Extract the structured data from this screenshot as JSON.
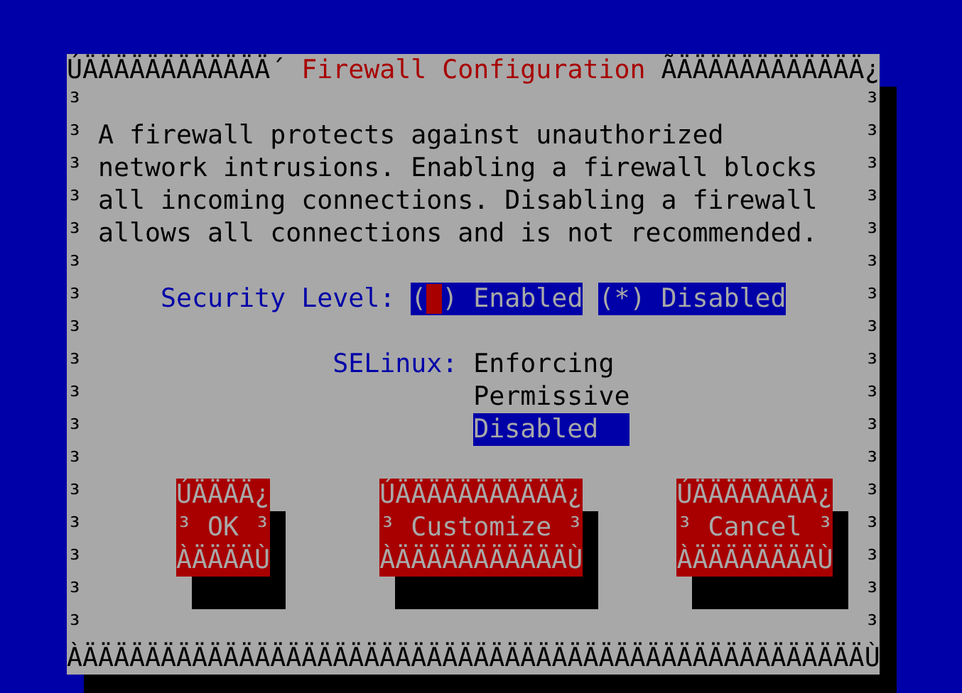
{
  "dialog": {
    "top_left": "ÚÄÄÄÄÄÄÄÄÄÄÄÄ´",
    "title": "Firewall Configuration",
    "top_right": "ÃÄÄÄÄÄÄÄÄÄÄÄÄ¿",
    "bottom": "ÀÄÄÄÄÄÄÄÄÄÄÄÄÄÄÄÄÄÄÄÄÄÄÄÄÄÄÄÄÄÄÄÄÄÄÄÄÄÄÄÄÄÄÄÄÄÄÄÄÄÄÙ",
    "left_border": [
      "³",
      "³",
      "³",
      "³",
      "³",
      "³",
      "³",
      "³",
      "³",
      "³",
      "³",
      "³",
      "³",
      "³",
      "³",
      "³",
      "³"
    ],
    "right_border": [
      "³",
      "³",
      "³",
      "³",
      "³",
      "³",
      "³",
      "³",
      "³",
      "³",
      "³",
      "³",
      "³",
      "³",
      "³",
      "³",
      "³"
    ]
  },
  "description": [
    "A firewall protects against unauthorized",
    "network intrusions. Enabling a firewall blocks",
    "all incoming connections. Disabling a firewall",
    "allows all connections and is not recommended."
  ],
  "security_level": {
    "label": "Security Level:",
    "brackets": [
      "(",
      ")"
    ],
    "mark_char": "*",
    "options": [
      {
        "label": "Enabled",
        "selected": false,
        "focused": true
      },
      {
        "label": "Disabled",
        "selected": true,
        "focused": false
      }
    ]
  },
  "selinux": {
    "label": "SELinux:",
    "options": [
      {
        "label": "Enforcing",
        "selected": false
      },
      {
        "label": "Permissive",
        "selected": false
      },
      {
        "label": "Disabled",
        "selected": true
      }
    ]
  },
  "buttons": [
    {
      "top": "ÚÄÄÄÄ¿",
      "left": "³",
      "label": "OK",
      "right": "³",
      "bottom": "ÀÄÄÄÄÙ"
    },
    {
      "top": "ÚÄÄÄÄÄÄÄÄÄÄÄ¿",
      "left": "³",
      "label": "Customize",
      "right": "³",
      "bottom": "ÀÄÄÄÄÄÄÄÄÄÄÄÙ"
    },
    {
      "top": "ÚÄÄÄÄÄÄÄÄ¿",
      "left": "³",
      "label": "Cancel",
      "right": "³",
      "bottom": "ÀÄÄÄÄÄÄÄÄÙ"
    }
  ]
}
